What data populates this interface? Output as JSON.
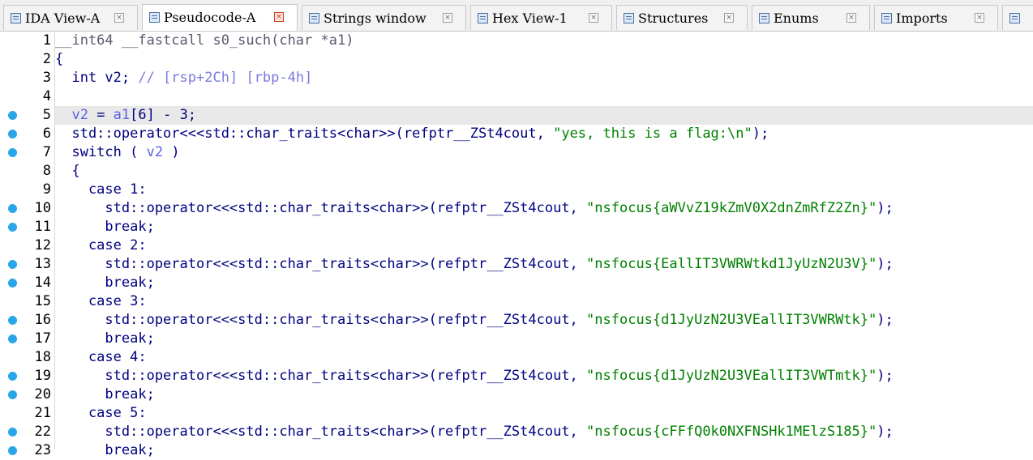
{
  "tabs": [
    {
      "label": "IDA View-A",
      "active": false,
      "icon": "ida-view-icon"
    },
    {
      "label": "Pseudocode-A",
      "active": true,
      "icon": "pseudocode-icon"
    },
    {
      "label": "Strings window",
      "active": false,
      "icon": "strings-icon"
    },
    {
      "label": "Hex View-1",
      "active": false,
      "icon": "hex-view-icon"
    },
    {
      "label": "Structures",
      "active": false,
      "icon": "structures-icon"
    },
    {
      "label": "Enums",
      "active": false,
      "icon": "enums-icon"
    },
    {
      "label": "Imports",
      "active": false,
      "icon": "imports-icon"
    }
  ],
  "tab_close_glyph": "×",
  "colors": {
    "keyword": "#000080",
    "variable": "#5f5fe8",
    "comment": "#7a7ae0",
    "string": "#008000",
    "breakpoint": "#2aa6e8",
    "current_line": "#e8e8e8"
  },
  "code_lines": [
    {
      "num": "1",
      "bp": false,
      "hl": false,
      "parts": [
        [
          "c-gray",
          "__int64 __fastcall s0_such(char *a1)"
        ]
      ]
    },
    {
      "num": "2",
      "bp": false,
      "hl": false,
      "parts": [
        [
          "c-name",
          "{"
        ]
      ]
    },
    {
      "num": "3",
      "bp": false,
      "hl": false,
      "parts": [
        [
          "c-name",
          "  int v2; "
        ],
        [
          "c-cmt",
          "// [rsp+2Ch] [rbp-4h]"
        ]
      ]
    },
    {
      "num": "4",
      "bp": false,
      "hl": false,
      "parts": []
    },
    {
      "num": "5",
      "bp": true,
      "hl": true,
      "parts": [
        [
          "c-var",
          "  v2"
        ],
        [
          "c-name",
          " = "
        ],
        [
          "c-var",
          "a1"
        ],
        [
          "c-name",
          "[6] - 3;"
        ]
      ]
    },
    {
      "num": "6",
      "bp": true,
      "hl": false,
      "parts": [
        [
          "c-name",
          "  std::operator<<<std::char_traits<char>>(refptr__ZSt4cout, "
        ],
        [
          "c-str",
          "\"yes, this is a flag:\\n\""
        ],
        [
          "c-name",
          ");"
        ]
      ]
    },
    {
      "num": "7",
      "bp": true,
      "hl": false,
      "parts": [
        [
          "c-name",
          "  switch ( "
        ],
        [
          "c-var",
          "v2"
        ],
        [
          "c-name",
          " )"
        ]
      ]
    },
    {
      "num": "8",
      "bp": false,
      "hl": false,
      "parts": [
        [
          "c-name",
          "  {"
        ]
      ]
    },
    {
      "num": "9",
      "bp": false,
      "hl": false,
      "parts": [
        [
          "c-name",
          "    case 1:"
        ]
      ]
    },
    {
      "num": "10",
      "bp": true,
      "hl": false,
      "parts": [
        [
          "c-name",
          "      std::operator<<<std::char_traits<char>>(refptr__ZSt4cout, "
        ],
        [
          "c-str",
          "\"nsfocus{aWVvZ19kZmV0X2dnZmRfZ2Zn}\""
        ],
        [
          "c-name",
          ");"
        ]
      ]
    },
    {
      "num": "11",
      "bp": true,
      "hl": false,
      "parts": [
        [
          "c-name",
          "      break;"
        ]
      ]
    },
    {
      "num": "12",
      "bp": false,
      "hl": false,
      "parts": [
        [
          "c-name",
          "    case 2:"
        ]
      ]
    },
    {
      "num": "13",
      "bp": true,
      "hl": false,
      "parts": [
        [
          "c-name",
          "      std::operator<<<std::char_traits<char>>(refptr__ZSt4cout, "
        ],
        [
          "c-str",
          "\"nsfocus{EallIT3VWRWtkd1JyUzN2U3V}\""
        ],
        [
          "c-name",
          ");"
        ]
      ]
    },
    {
      "num": "14",
      "bp": true,
      "hl": false,
      "parts": [
        [
          "c-name",
          "      break;"
        ]
      ]
    },
    {
      "num": "15",
      "bp": false,
      "hl": false,
      "parts": [
        [
          "c-name",
          "    case 3:"
        ]
      ]
    },
    {
      "num": "16",
      "bp": true,
      "hl": false,
      "parts": [
        [
          "c-name",
          "      std::operator<<<std::char_traits<char>>(refptr__ZSt4cout, "
        ],
        [
          "c-str",
          "\"nsfocus{d1JyUzN2U3VEallIT3VWRWtk}\""
        ],
        [
          "c-name",
          ");"
        ]
      ]
    },
    {
      "num": "17",
      "bp": true,
      "hl": false,
      "parts": [
        [
          "c-name",
          "      break;"
        ]
      ]
    },
    {
      "num": "18",
      "bp": false,
      "hl": false,
      "parts": [
        [
          "c-name",
          "    case 4:"
        ]
      ]
    },
    {
      "num": "19",
      "bp": true,
      "hl": false,
      "parts": [
        [
          "c-name",
          "      std::operator<<<std::char_traits<char>>(refptr__ZSt4cout, "
        ],
        [
          "c-str",
          "\"nsfocus{d1JyUzN2U3VEallIT3VWTmtk}\""
        ],
        [
          "c-name",
          ");"
        ]
      ]
    },
    {
      "num": "20",
      "bp": true,
      "hl": false,
      "parts": [
        [
          "c-name",
          "      break;"
        ]
      ]
    },
    {
      "num": "21",
      "bp": false,
      "hl": false,
      "parts": [
        [
          "c-name",
          "    case 5:"
        ]
      ]
    },
    {
      "num": "22",
      "bp": true,
      "hl": false,
      "parts": [
        [
          "c-name",
          "      std::operator<<<std::char_traits<char>>(refptr__ZSt4cout, "
        ],
        [
          "c-str",
          "\"nsfocus{cFFfQ0k0NXFNSHk1MElzS185}\""
        ],
        [
          "c-name",
          ");"
        ]
      ]
    },
    {
      "num": "23",
      "bp": true,
      "hl": false,
      "parts": [
        [
          "c-name",
          "      break;"
        ]
      ]
    }
  ]
}
